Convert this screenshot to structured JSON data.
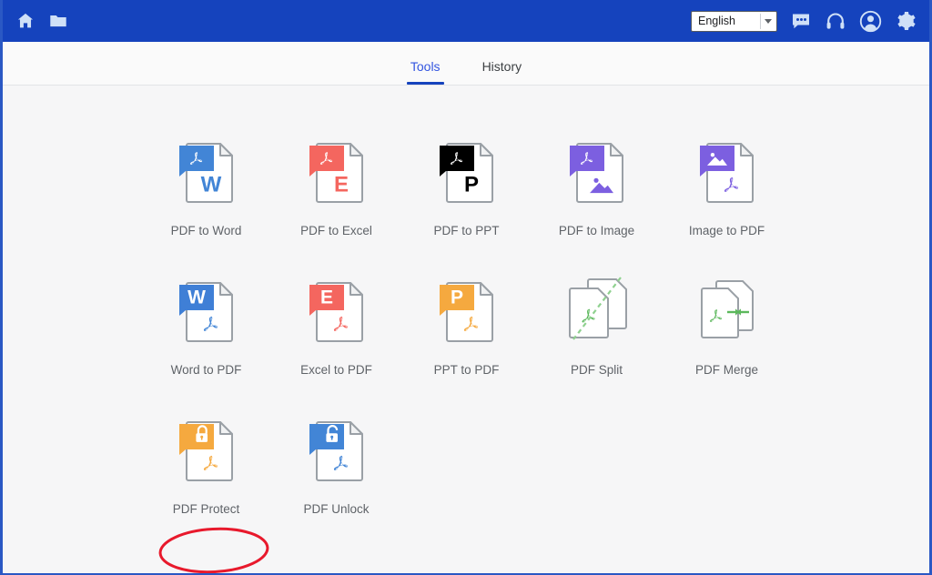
{
  "window": {
    "border_color": "#2a58c4",
    "background": "#f6f6f7"
  },
  "header": {
    "background": "#1543bd",
    "home_icon": "home-icon",
    "folder_icon": "folder-icon",
    "language": {
      "value": "English",
      "caret_icon": "chevron-down-icon"
    },
    "chat_icon": "chat-bubble-icon",
    "support_icon": "headset-icon",
    "account_icon": "user-avatar-icon",
    "settings_icon": "gear-icon"
  },
  "tabs": {
    "active": "Tools",
    "items": [
      {
        "label": "Tools",
        "active": true
      },
      {
        "label": "History",
        "active": false
      }
    ],
    "active_color": "#3355e0",
    "indicator_color": "#1543bd",
    "inactive_color": "#3c4043"
  },
  "tools": {
    "rows": [
      [
        {
          "label": "PDF to Word",
          "badge_color": "#4285d6",
          "badge_glyph": "pdf-logo",
          "body_glyph": "letter-W",
          "body_color": "#4285d6"
        },
        {
          "label": "PDF to Excel",
          "badge_color": "#f4665f",
          "badge_glyph": "pdf-logo",
          "body_glyph": "letter-E",
          "body_color": "#f4665f"
        },
        {
          "label": "PDF to PPT",
          "badge_color": "#f5a council",
          "badge_glyph": "pdf-logo",
          "body_glyph": "letter-P",
          "body_color": "#f5a councils"
        },
        {
          "label": "PDF to Image",
          "badge_color": "#7c5fe0",
          "badge_glyph": "pdf-logo",
          "body_glyph": "picture",
          "body_color": "#7c5fe0"
        },
        {
          "label": "Image to PDF",
          "badge_color": "#7c5fe0",
          "badge_glyph": "picture",
          "body_glyph": "pdf-logo",
          "body_color": "#7c5fe0"
        }
      ],
      [
        {
          "label": "Word to PDF",
          "badge_color": "#3f7fd6",
          "badge_glyph": "letter-W",
          "body_glyph": "pdf-logo",
          "body_color": "#4285d6"
        },
        {
          "label": "Excel to PDF",
          "badge_color": "#f4665f",
          "badge_glyph": "letter-E",
          "body_glyph": "pdf-logo",
          "body_color": "#f4665f"
        },
        {
          "label": "PPT to PDF",
          "badge_color": "#f5a93f",
          "badge_glyph": "letter-P",
          "body_glyph": "pdf-logo",
          "body_color": "#f5a93f"
        },
        {
          "label": "PDF Split",
          "badge_color": "none",
          "badge_glyph": "split",
          "body_glyph": "pdf-logo",
          "body_color": "#5cb85c"
        },
        {
          "label": "PDF Merge",
          "badge_color": "none",
          "badge_glyph": "merge",
          "body_glyph": "pdf-logo",
          "body_color": "#5cb85c"
        }
      ],
      [
        {
          "label": "PDF Protect",
          "badge_color": "#f5a93f",
          "badge_glyph": "lock-closed",
          "body_glyph": "pdf-logo",
          "body_color": "#f5a93f"
        },
        {
          "label": "PDF Unlock",
          "badge_color": "#4285d6",
          "badge_glyph": "lock-open",
          "body_glyph": "pdf-logo",
          "body_color": "#4285d6"
        }
      ]
    ],
    "doc_outline_color": "#9aa0a6",
    "label_color": "#5f6368"
  },
  "annotation": {
    "type": "ellipse",
    "color": "#e8192c",
    "target": "PDF Protect"
  }
}
